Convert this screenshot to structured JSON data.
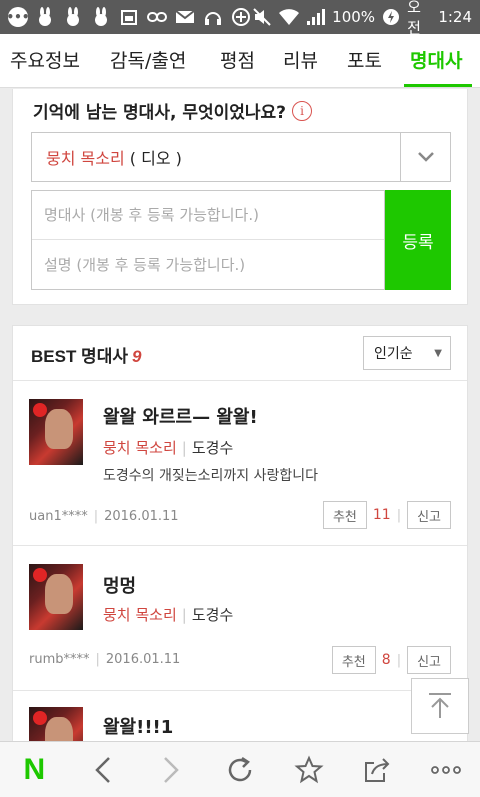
{
  "status_bar": {
    "battery": "100%",
    "ampm": "오전",
    "time": "1:24"
  },
  "tabs": [
    {
      "label": "주요정보"
    },
    {
      "label": "감독/출연"
    },
    {
      "label": "평점"
    },
    {
      "label": "리뷰"
    },
    {
      "label": "포토"
    },
    {
      "label": "명대사",
      "active": true
    }
  ],
  "write": {
    "question": "기억에 남는 명대사, 무엇이었나요?",
    "info_icon": "i",
    "selected_role": "뭉치 목소리",
    "selected_actor": "( 디오 )",
    "quote_placeholder": "명대사 (개봉 후 등록 가능합니다.)",
    "desc_placeholder": "설명 (개봉 후 등록 가능합니다.)",
    "register_label": "등록"
  },
  "best": {
    "title": "BEST 명대사",
    "count": "9",
    "sort_label": "인기순",
    "items": [
      {
        "quote": "왈왈 와르르— 왈왈!",
        "film_role": "뭉치 목소리",
        "actor": "도경수",
        "desc": "도경수의 개짖는소리까지 사랑합니다",
        "author": "uan1****",
        "date": "2016.01.11",
        "rec_label": "추천",
        "rec_count": "11",
        "report_label": "신고"
      },
      {
        "quote": "멍멍",
        "film_role": "뭉치 목소리",
        "actor": "도경수",
        "desc": "",
        "author": "rumb****",
        "date": "2016.01.11",
        "rec_label": "추천",
        "rec_count": "8",
        "report_label": "신고"
      },
      {
        "quote": "왈왈!!!1"
      }
    ]
  },
  "colors": {
    "accent": "#1ec800",
    "red": "#d0463f"
  },
  "bottom_nav": {
    "logo": "N",
    "icons": [
      "back-icon",
      "forward-icon",
      "refresh-icon",
      "star-icon",
      "share-icon",
      "more-icon"
    ]
  }
}
